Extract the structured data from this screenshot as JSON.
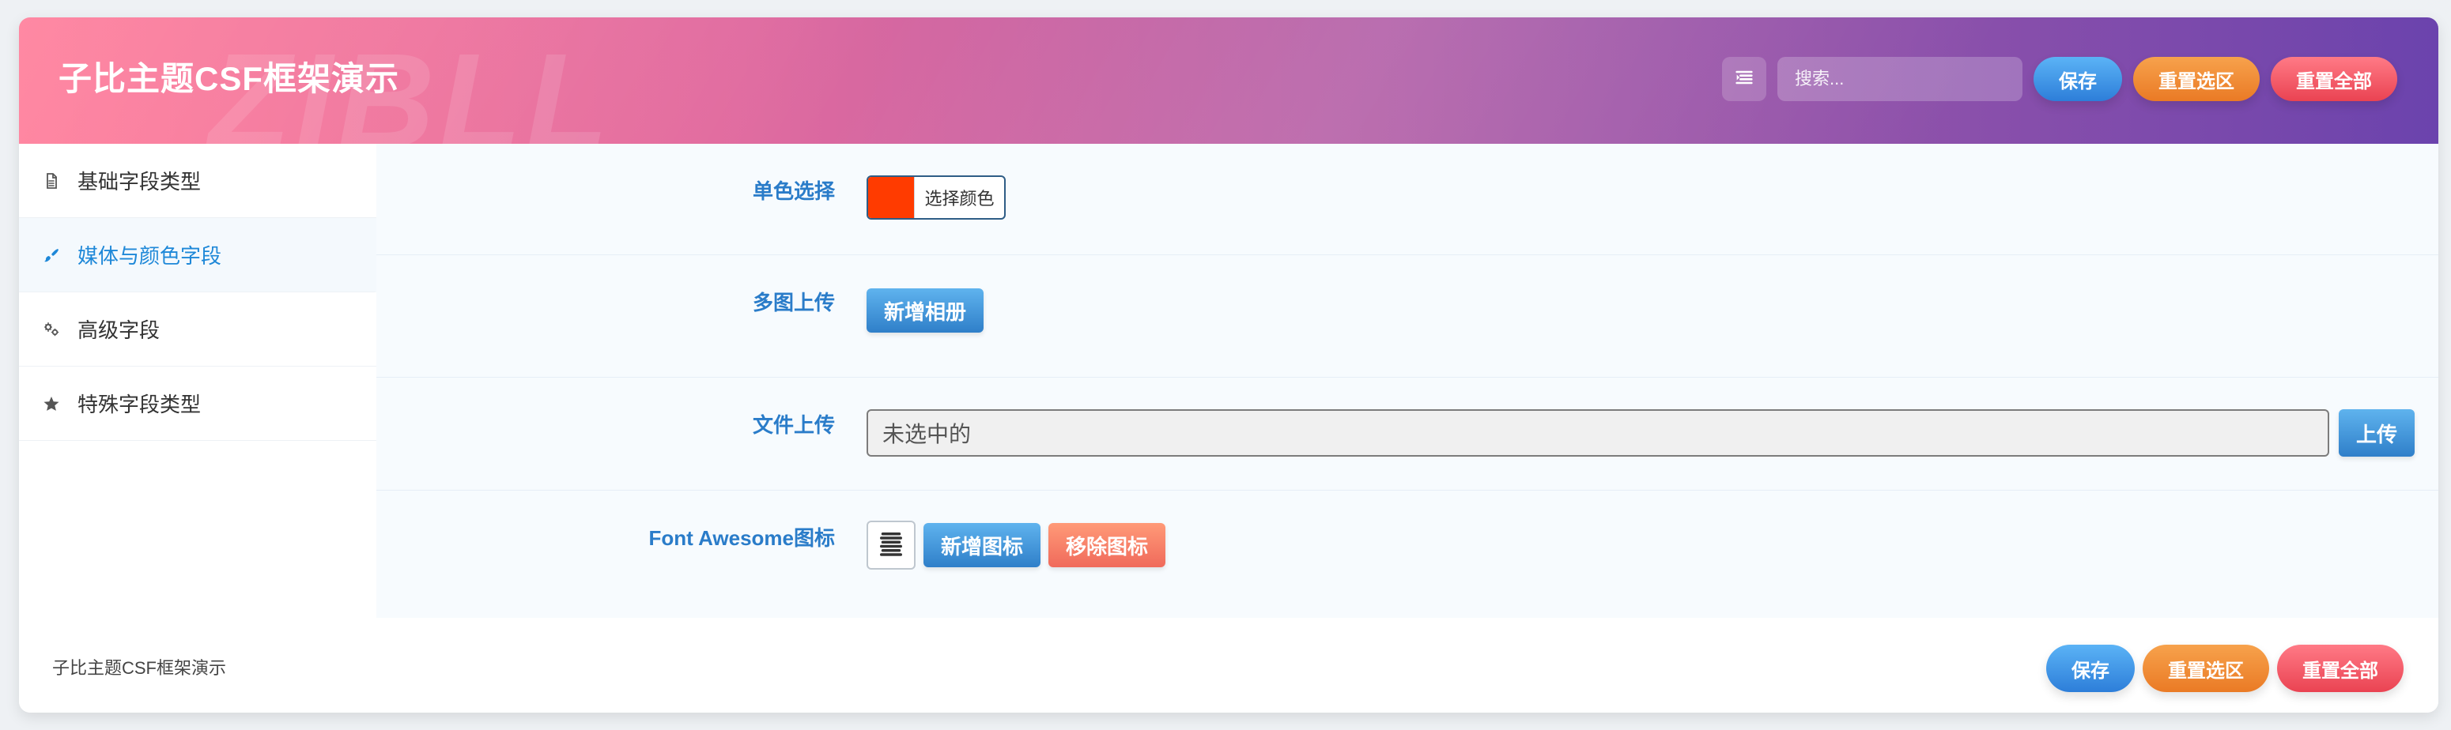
{
  "header": {
    "title": "子比主题CSF框架演示",
    "watermark": "ZIBLL",
    "search_placeholder": "搜索...",
    "buttons": {
      "save": "保存",
      "reset_section": "重置选区",
      "reset_all": "重置全部"
    },
    "menu_icon": "list-indent-icon"
  },
  "sidebar": {
    "items": [
      {
        "label": "基础字段类型",
        "icon": "file-icon",
        "active": false
      },
      {
        "label": "媒体与颜色字段",
        "icon": "brush-icon",
        "active": true
      },
      {
        "label": "高级字段",
        "icon": "gears-icon",
        "active": false
      },
      {
        "label": "特殊字段类型",
        "icon": "star-icon",
        "active": false
      }
    ]
  },
  "content": {
    "rows": [
      {
        "label": "单色选择",
        "color_picker": {
          "color": "#ff3b00",
          "text": "选择颜色"
        }
      },
      {
        "label": "多图上传",
        "button": "新增相册"
      },
      {
        "label": "文件上传",
        "file_value": "未选中的",
        "upload": "上传"
      },
      {
        "label": "Font Awesome图标",
        "add": "新增图标",
        "remove": "移除图标",
        "preview_icon": "align-justify-icon"
      }
    ]
  },
  "footer": {
    "title": "子比主题CSF框架演示",
    "buttons": {
      "save": "保存",
      "reset_section": "重置选区",
      "reset_all": "重置全部"
    }
  }
}
